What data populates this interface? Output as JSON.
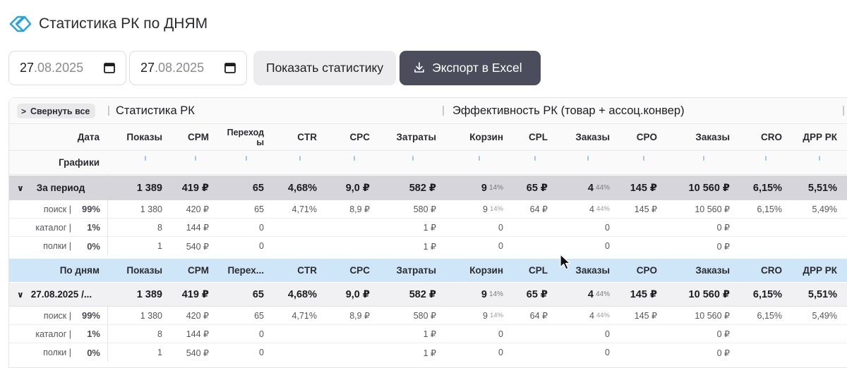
{
  "page": {
    "title": "Статистика РК по ДНЯМ"
  },
  "filters": {
    "date_from": {
      "day": "27",
      "rest": ".08.2025"
    },
    "date_to": {
      "day": "27",
      "rest": ".08.2025"
    },
    "show_button": "Показать статистику",
    "export_button": "Экспорт в Excel"
  },
  "table": {
    "collapse_all": "Свернуть все",
    "groups": [
      "Статистика РК",
      "Эффективность РК (товар + ассоц.конвер)"
    ],
    "date_header": "Дата",
    "charts_label": "Графики",
    "columns": [
      "Показы",
      "CPM",
      "Переходы",
      "CTR",
      "CPC",
      "Затраты",
      "Корзин",
      "CPL",
      "Заказы",
      "CPO",
      "Заказы",
      "CRO",
      "ДРР РК"
    ],
    "columns_short": [
      "Показы",
      "CPM",
      "Перех...",
      "CTR",
      "CPC",
      "Затраты",
      "Корзин",
      "CPL",
      "Заказы",
      "CPO",
      "Заказы",
      "CRO",
      "ДРР РК"
    ],
    "period": {
      "label": "За период",
      "values": [
        "1 389",
        "419 ₽",
        "65",
        "4,68%",
        "9,0 ₽",
        "582 ₽",
        "9",
        "65 ₽",
        "4",
        "145 ₽",
        "10 560 ₽",
        "6,15%",
        "5,51%"
      ],
      "korzin_pct": "14%",
      "zakazy_pct": "44%",
      "sources": [
        {
          "name": "поиск |",
          "share": "99%",
          "values": [
            "1 380",
            "420 ₽",
            "65",
            "4,71%",
            "8,9 ₽",
            "580 ₽",
            "9",
            "64 ₽",
            "4",
            "145 ₽",
            "10 560 ₽",
            "6,15%",
            "5,49%"
          ],
          "korzin_pct": "14%",
          "zakazy_pct": "44%"
        },
        {
          "name": "каталог |",
          "share": "1%",
          "values": [
            "8",
            "144 ₽",
            "0",
            "",
            "",
            "1 ₽",
            "0",
            "",
            "0",
            "",
            "0 ₽",
            "",
            ""
          ],
          "korzin_pct": "",
          "zakazy_pct": ""
        },
        {
          "name": "полки |",
          "share": "0%",
          "values": [
            "1",
            "540 ₽",
            "0",
            "",
            "",
            "1 ₽",
            "0",
            "",
            "0",
            "",
            "0 ₽",
            "",
            ""
          ],
          "korzin_pct": "",
          "zakazy_pct": ""
        }
      ]
    },
    "by_days_label": "По дням",
    "day": {
      "label": "27.08.2025 /...",
      "values": [
        "1 389",
        "419 ₽",
        "65",
        "4,68%",
        "9,0 ₽",
        "582 ₽",
        "9",
        "65 ₽",
        "4",
        "145 ₽",
        "10 560 ₽",
        "6,15%",
        "5,51%"
      ],
      "korzin_pct": "14%",
      "zakazy_pct": "44%",
      "sources": [
        {
          "name": "поиск |",
          "share": "99%",
          "values": [
            "1 380",
            "420 ₽",
            "65",
            "4,71%",
            "8,9 ₽",
            "580 ₽",
            "9",
            "64 ₽",
            "4",
            "145 ₽",
            "10 560 ₽",
            "6,15%",
            "5,49%"
          ],
          "korzin_pct": "14%",
          "zakazy_pct": "44%"
        },
        {
          "name": "каталог |",
          "share": "1%",
          "values": [
            "8",
            "144 ₽",
            "0",
            "",
            "",
            "1 ₽",
            "0",
            "",
            "0",
            "",
            "0 ₽",
            "",
            ""
          ],
          "korzin_pct": "",
          "zakazy_pct": ""
        },
        {
          "name": "полки |",
          "share": "0%",
          "values": [
            "1",
            "540 ₽",
            "0",
            "",
            "",
            "1 ₽",
            "0",
            "",
            "0",
            "",
            "0 ₽",
            "",
            ""
          ],
          "korzin_pct": "",
          "zakazy_pct": ""
        }
      ]
    }
  },
  "icons": {
    "logo": "logo-icon",
    "calendar": "calendar-icon",
    "download": "download-icon",
    "chevron": "chevron-icon",
    "cursor": "mouse-cursor-icon"
  },
  "colors": {
    "accent": "#2aa3d8",
    "export_bg": "#4b4c5c",
    "period_bg": "#d6d5db",
    "days_bg": "#cfe6f8"
  }
}
